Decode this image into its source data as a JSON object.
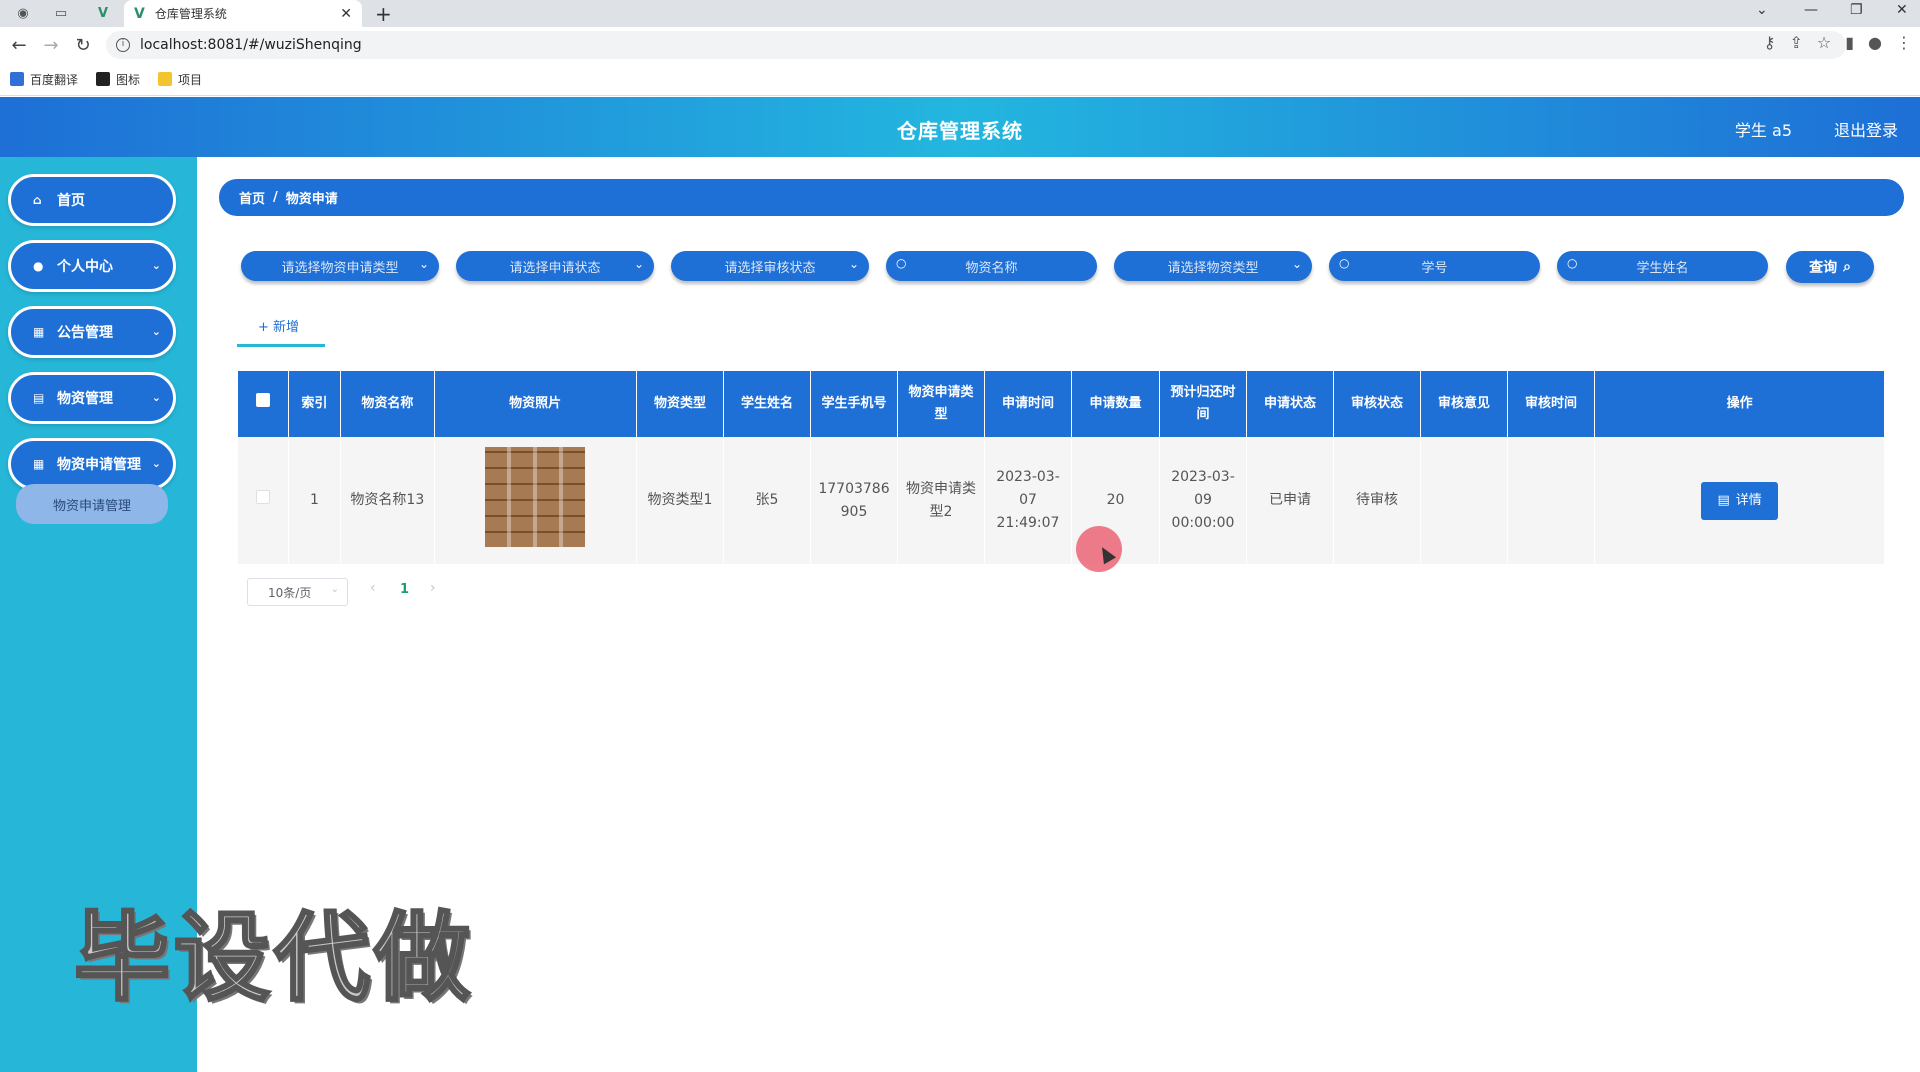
{
  "browser": {
    "tab_title": "仓库管理系统",
    "url": "localhost:8081/#/wuziShenqing",
    "bookmarks": [
      "百度翻译",
      "图标",
      "项目"
    ]
  },
  "header": {
    "title": "仓库管理系统",
    "user": "学生 a5",
    "logout": "退出登录"
  },
  "sidebar": {
    "items": [
      {
        "label": "首页",
        "icon": "home-icon"
      },
      {
        "label": "个人中心",
        "icon": "user-icon"
      },
      {
        "label": "公告管理",
        "icon": "grid-icon"
      },
      {
        "label": "物资管理",
        "icon": "clipboard-icon"
      },
      {
        "label": "物资申请管理",
        "icon": "grid-icon"
      }
    ],
    "submenu": "物资申请管理"
  },
  "breadcrumb": {
    "home": "首页",
    "separator": "/",
    "current": "物资申请"
  },
  "filters": {
    "apply_type": "请选择物资申请类型",
    "apply_status": "请选择申请状态",
    "review_status": "请选择审核状态",
    "goods_name": "物资名称",
    "goods_type": "请选择物资类型",
    "student_no": "学号",
    "student_name": "学生姓名",
    "query": "查询"
  },
  "actions": {
    "add": "+ 新增"
  },
  "table": {
    "headers": [
      "索引",
      "物资名称",
      "物资照片",
      "物资类型",
      "学生姓名",
      "学生手机号",
      "物资申请类型",
      "申请时间",
      "申请数量",
      "预计归还时间",
      "申请状态",
      "审核状态",
      "审核意见",
      "审核时间",
      "操作"
    ],
    "rows": [
      {
        "index": "1",
        "goods_name": "物资名称13",
        "goods_type": "物资类型1",
        "student_name": "张5",
        "phone": "17703786905",
        "apply_type": "物资申请类型2",
        "apply_time": "2023-03-07 21:49:07",
        "quantity": "20",
        "return_time": "2023-03-09 00:00:00",
        "apply_status": "已申请",
        "review_status": "待审核",
        "review_opinion": "",
        "review_time": "",
        "detail": "详情"
      }
    ]
  },
  "pagination": {
    "page_size": "10条/页",
    "current_page": "1"
  },
  "watermark": "毕设代做"
}
